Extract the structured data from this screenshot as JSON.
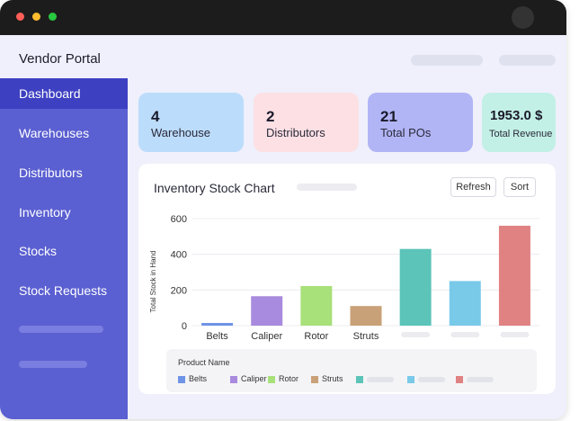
{
  "app": {
    "title": "Vendor Portal"
  },
  "sidebar": {
    "items": [
      {
        "label": "Dashboard",
        "active": true
      },
      {
        "label": "Warehouses"
      },
      {
        "label": "Distributors"
      },
      {
        "label": "Inventory"
      },
      {
        "label": "Stocks"
      },
      {
        "label": "Stock Requests"
      }
    ]
  },
  "stats": [
    {
      "value": "4",
      "label": "Warehouse",
      "color": "#bcdcfb"
    },
    {
      "value": "2",
      "label": "Distributors",
      "color": "#fde0e4"
    },
    {
      "value": "21",
      "label": "Total POs",
      "color": "#b1b5f5"
    },
    {
      "value": "1953.0 $",
      "label": "Total Revenue",
      "color": "#c3f0e6"
    }
  ],
  "panel": {
    "title": "Inventory Stock Chart",
    "refresh_label": "Refresh",
    "sort_label": "Sort"
  },
  "chart_data": {
    "type": "bar",
    "categories": [
      "Belts",
      "Caliper",
      "Rotor",
      "Struts",
      "",
      "",
      ""
    ],
    "values": [
      15,
      165,
      222,
      110,
      430,
      250,
      560
    ],
    "colors": [
      "#6f93e6",
      "#a88ade",
      "#a8e07a",
      "#c9a178",
      "#5cc4b8",
      "#79c9e8",
      "#e08282"
    ],
    "ylabel": "Total Stock in Hand",
    "yticks": [
      0,
      200,
      400,
      600
    ],
    "ylim": [
      0,
      600
    ],
    "legend_title": "Product Name",
    "legend_placement": "bottom",
    "grid": true
  }
}
